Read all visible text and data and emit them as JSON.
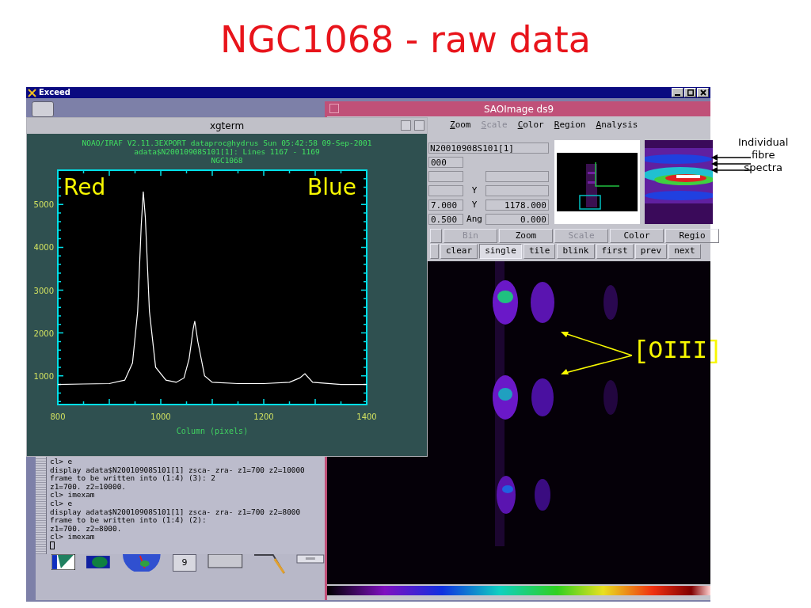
{
  "slide": {
    "title": "NGC1068 - raw data"
  },
  "desktop": {
    "title": "Exceed",
    "calendar_day": "9"
  },
  "ds9": {
    "title": "SAOImage ds9",
    "menu": [
      {
        "label": "Zoom",
        "disabled": false
      },
      {
        "label": "Scale",
        "disabled": true
      },
      {
        "label": "Color",
        "disabled": false
      },
      {
        "label": "Region",
        "disabled": false
      },
      {
        "label": "Analysis",
        "disabled": false
      }
    ],
    "info_rows": [
      [
        {
          "kind": "wide",
          "value": "N20010908S101[1]"
        }
      ],
      [
        {
          "kind": "field",
          "value": "000"
        }
      ],
      [
        {
          "kind": "field"
        },
        {
          "kind": "gap"
        },
        {
          "kind": "field"
        }
      ],
      [
        {
          "kind": "field"
        },
        {
          "kind": "label",
          "text": "Y"
        },
        {
          "kind": "field"
        }
      ],
      [
        {
          "kind": "field",
          "value": "7.000"
        },
        {
          "kind": "label",
          "text": "Y"
        },
        {
          "kind": "field",
          "value": "1178.000"
        }
      ],
      [
        {
          "kind": "field",
          "value": "0.500"
        },
        {
          "kind": "label",
          "text": "Ang"
        },
        {
          "kind": "field",
          "value": "0.000"
        }
      ]
    ],
    "button_bar": [
      {
        "label": "Bin",
        "disabled": true
      },
      {
        "label": "Zoom",
        "disabled": false
      },
      {
        "label": "Scale",
        "disabled": true
      },
      {
        "label": "Color",
        "disabled": false
      },
      {
        "label": "Regio",
        "disabled": false
      }
    ],
    "frame_buttons": [
      {
        "label": "clear",
        "selected": false
      },
      {
        "label": "single",
        "selected": true
      },
      {
        "label": "tile",
        "selected": false
      },
      {
        "label": "blink",
        "selected": false
      },
      {
        "label": "first",
        "selected": false
      },
      {
        "label": "prev",
        "selected": false
      },
      {
        "label": "next",
        "selected": false
      }
    ]
  },
  "xgterm": {
    "title": "xgterm",
    "header_lines": [
      "NOAO/IRAF V2.11.3EXPORT dataproc@hydrus Sun 05:42:58 09-Sep-2001",
      "adata$N20010908S101[1]: Lines 1167 - 1169",
      "NGC1068"
    ],
    "chart_data": {
      "type": "line",
      "xlabel": "Column (pixels)",
      "xlim": [
        800,
        1400
      ],
      "ylim": [
        330,
        5800
      ],
      "xticks": [
        800,
        1000,
        1200,
        1400
      ],
      "yticks": [
        1000,
        2000,
        3000,
        4000,
        5000
      ],
      "x": [
        800,
        850,
        900,
        930,
        945,
        955,
        962,
        966,
        970,
        978,
        990,
        1010,
        1030,
        1045,
        1055,
        1063,
        1066,
        1072,
        1085,
        1100,
        1150,
        1200,
        1250,
        1270,
        1280,
        1295,
        1350,
        1400
      ],
      "series": [
        {
          "color": "#ffffff",
          "values": [
            800,
            810,
            820,
            900,
            1300,
            2500,
            4500,
            5300,
            4700,
            2500,
            1200,
            900,
            850,
            950,
            1400,
            2100,
            2280,
            1800,
            1000,
            850,
            820,
            820,
            850,
            950,
            1050,
            850,
            800,
            800
          ]
        }
      ]
    }
  },
  "terminal": {
    "lines": [
      "cl> e",
      "display adata$N20010908S101[1] zsca- zra- z1=700 z2=10000",
      "frame to be written into (1:4) (3): 2",
      "z1=700. z2=10000.",
      "cl> imexam",
      "cl> e",
      "display adata$N20010908S101[1] zsca- zra- z1=700 z2=8000",
      "frame to be written into (1:4) (2):",
      "z1=700. z2=8000.",
      "cl> imexam"
    ]
  },
  "annotations": {
    "spectrum_labels": [
      "Red",
      "Blue"
    ],
    "line_label": "[OIII]",
    "fibre_label": [
      "Individual",
      "fibre",
      "spectra"
    ]
  }
}
